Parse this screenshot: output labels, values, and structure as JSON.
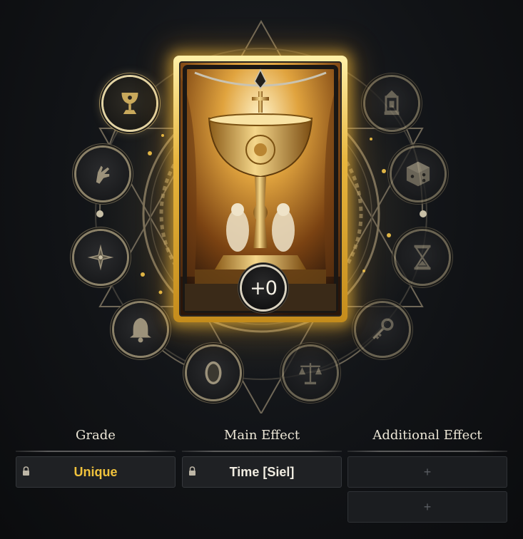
{
  "card": {
    "level_label": "+0",
    "glow_color": "#f3c14a"
  },
  "medallions": [
    {
      "icon": "chalice-icon",
      "state": "selected"
    },
    {
      "icon": "hand-icon",
      "state": "normal"
    },
    {
      "icon": "compass-icon",
      "state": "normal"
    },
    {
      "icon": "bell-icon",
      "state": "normal"
    },
    {
      "icon": "mirror-icon",
      "state": "normal"
    },
    {
      "icon": "scales-icon",
      "state": "dim"
    },
    {
      "icon": "key-icon",
      "state": "dim"
    },
    {
      "icon": "hourglass-icon",
      "state": "dim"
    },
    {
      "icon": "die-icon",
      "state": "dim"
    },
    {
      "icon": "lantern-icon",
      "state": "dim"
    }
  ],
  "sections": {
    "grade": {
      "title": "Grade",
      "value": "Unique",
      "value_color": "#f0c23c",
      "locked": true
    },
    "main_effect": {
      "title": "Main Effect",
      "value": "Time [Siel]",
      "value_color": "#f1ede2",
      "locked": true
    },
    "additional_effect": {
      "title": "Additional Effect",
      "slots": [
        "+",
        "+"
      ]
    }
  }
}
